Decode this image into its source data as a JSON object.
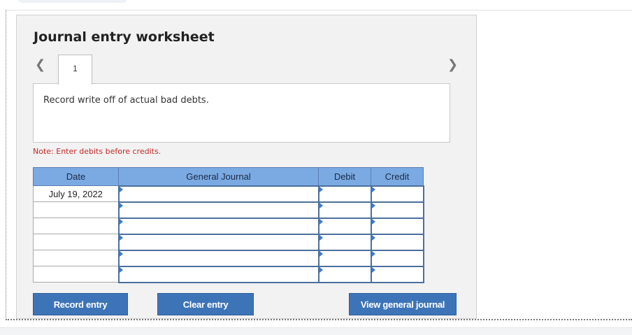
{
  "worksheet": {
    "title": "Journal entry worksheet",
    "current_page": "1",
    "instruction": "Record write off of actual bad debts.",
    "note": "Note: Enter debits before credits."
  },
  "table": {
    "headers": {
      "date": "Date",
      "general_journal": "General Journal",
      "debit": "Debit",
      "credit": "Credit"
    },
    "rows": [
      {
        "date": "July 19, 2022",
        "account": "",
        "debit": "",
        "credit": ""
      },
      {
        "date": "",
        "account": "",
        "debit": "",
        "credit": ""
      },
      {
        "date": "",
        "account": "",
        "debit": "",
        "credit": ""
      },
      {
        "date": "",
        "account": "",
        "debit": "",
        "credit": ""
      },
      {
        "date": "",
        "account": "",
        "debit": "",
        "credit": ""
      },
      {
        "date": "",
        "account": "",
        "debit": "",
        "credit": ""
      }
    ]
  },
  "buttons": {
    "record": "Record entry",
    "clear": "Clear entry",
    "view": "View general journal"
  },
  "icons": {
    "prev": "chevron-left-icon",
    "next": "chevron-right-icon"
  },
  "colors": {
    "header_bg": "#7baae3",
    "button_bg": "#3d74b8",
    "note_text": "#c62828"
  }
}
